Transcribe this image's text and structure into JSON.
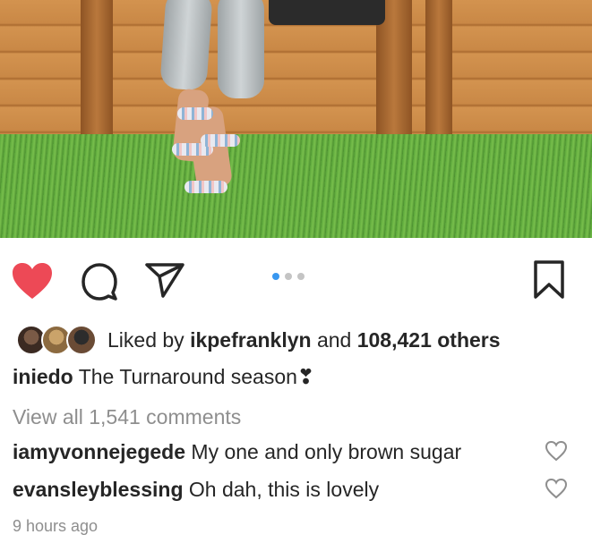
{
  "post_image": {
    "description_icon": "photo"
  },
  "actions": {
    "like_icon": "heart-filled-icon",
    "like_color": "#ed4956",
    "comment_icon": "comment-icon",
    "share_icon": "paper-plane-icon",
    "save_icon": "bookmark-icon",
    "carousel": {
      "count": 3,
      "active_index": 0,
      "active_color": "#3897f0"
    }
  },
  "likes": {
    "prefix": "Liked by ",
    "user": "ikpefranklyn",
    "connector": " and ",
    "others": "108,421 others"
  },
  "caption": {
    "username": "iniedo",
    "text": " The Turnaround season❣"
  },
  "view_all_comments": "View all 1,541 comments",
  "comments": [
    {
      "username": "iamyvonnejegede",
      "text": " My one and only brown sugar"
    },
    {
      "username": "evansleyblessing",
      "text": " Oh dah, this is lovely"
    }
  ],
  "timestamp": "9 hours ago"
}
